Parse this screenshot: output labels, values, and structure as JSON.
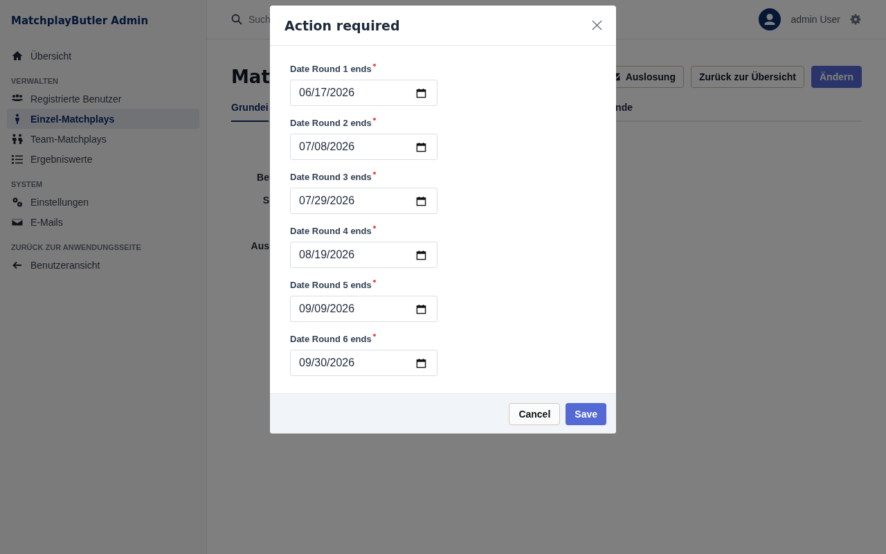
{
  "sidebar": {
    "brand": "MatchplayButler Admin",
    "sections": [
      {
        "items": [
          {
            "label": "Übersicht",
            "selected": false
          }
        ]
      },
      {
        "heading": "VERWALTEN",
        "items": [
          {
            "label": "Registrierte Benutzer",
            "selected": false
          },
          {
            "label": "Einzel-Matchplays",
            "selected": true
          },
          {
            "label": "Team-Matchplays",
            "selected": false
          },
          {
            "label": "Ergebniswerte",
            "selected": false
          }
        ]
      },
      {
        "heading": "SYSTEM",
        "items": [
          {
            "label": "Einstellungen",
            "selected": false
          },
          {
            "label": "E-Mails",
            "selected": false
          }
        ]
      },
      {
        "heading": "ZURÜCK ZUR ANWENDUNGSSEITE",
        "items": [
          {
            "label": "Benutzeransicht",
            "selected": false
          }
        ]
      }
    ]
  },
  "header": {
    "search_placeholder": "Such",
    "user": "admin User"
  },
  "page": {
    "title": "Mat",
    "buttons": [
      "Auslosung",
      "Zurück zur Übersicht",
      "Ändern"
    ],
    "tabs": [
      {
        "label": "Grundei",
        "selected": true
      },
      {
        "label": "nde",
        "selected": false
      }
    ],
    "field_labels": [
      "Be",
      "S",
      "Aus"
    ]
  },
  "dialog": {
    "title": "Action required",
    "fields": [
      {
        "label": "Date Round 1 ends",
        "required": true,
        "value": "06/17/2026"
      },
      {
        "label": "Date Round 2 ends",
        "required": true,
        "value": "07/08/2026"
      },
      {
        "label": "Date Round 3 ends",
        "required": true,
        "value": "07/29/2026"
      },
      {
        "label": "Date Round 4 ends",
        "required": true,
        "value": "08/19/2026"
      },
      {
        "label": "Date Round 5 ends",
        "required": true,
        "value": "09/09/2026"
      },
      {
        "label": "Date Round 6 ends",
        "required": true,
        "value": "09/30/2026"
      }
    ],
    "cancel": "Cancel",
    "save": "Save"
  }
}
